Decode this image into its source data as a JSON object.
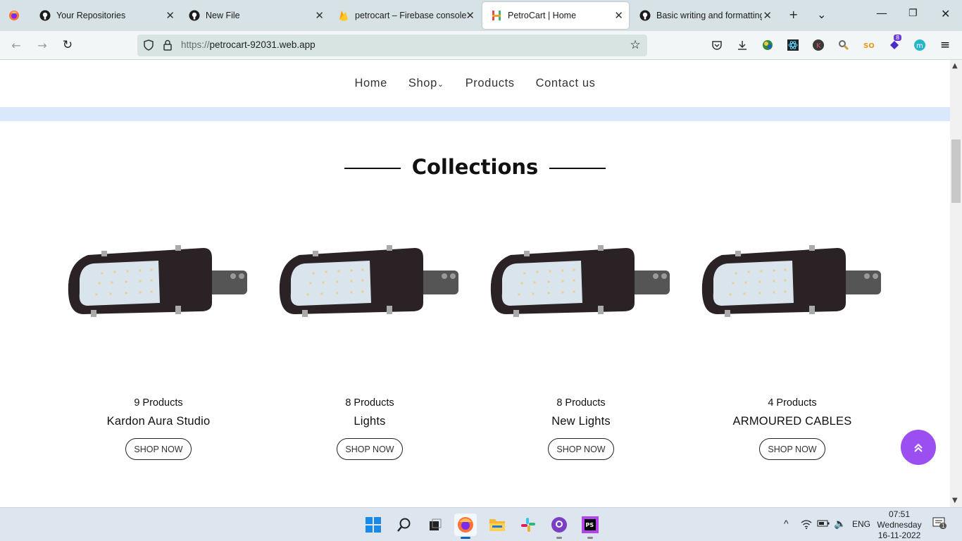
{
  "browser": {
    "tabs": [
      {
        "title": "Your Repositories",
        "icon": "github-icon"
      },
      {
        "title": "New File",
        "icon": "github-icon"
      },
      {
        "title": "petrocart – Firebase console",
        "icon": "firebase-icon"
      },
      {
        "title": "PetroCart | Home",
        "icon": "petrocart-icon",
        "active": true
      },
      {
        "title": "Basic writing and formatting",
        "icon": "github-icon"
      }
    ],
    "url_scheme": "https://",
    "url_host": "petrocart-92031.web.app",
    "extension_badge": "8"
  },
  "site": {
    "nav": [
      {
        "label": "Home"
      },
      {
        "label": "Shop"
      },
      {
        "label": "Products"
      },
      {
        "label": "Contact us"
      }
    ],
    "section_title": "Collections",
    "collections": [
      {
        "count": "9 Products",
        "name": "Kardon Aura Studio",
        "button": "SHOP NOW"
      },
      {
        "count": "8 Products",
        "name": "Lights",
        "button": "SHOP NOW"
      },
      {
        "count": "8 Products",
        "name": "New Lights",
        "button": "SHOP NOW"
      },
      {
        "count": "4 Products",
        "name": "ARMOURED CABLES",
        "button": "SHOP NOW"
      }
    ],
    "accent_color": "#9c4ff0"
  },
  "taskbar": {
    "language": "ENG",
    "time": "07:51",
    "day": "Wednesday",
    "date": "16-11-2022",
    "notification_count": "1"
  }
}
